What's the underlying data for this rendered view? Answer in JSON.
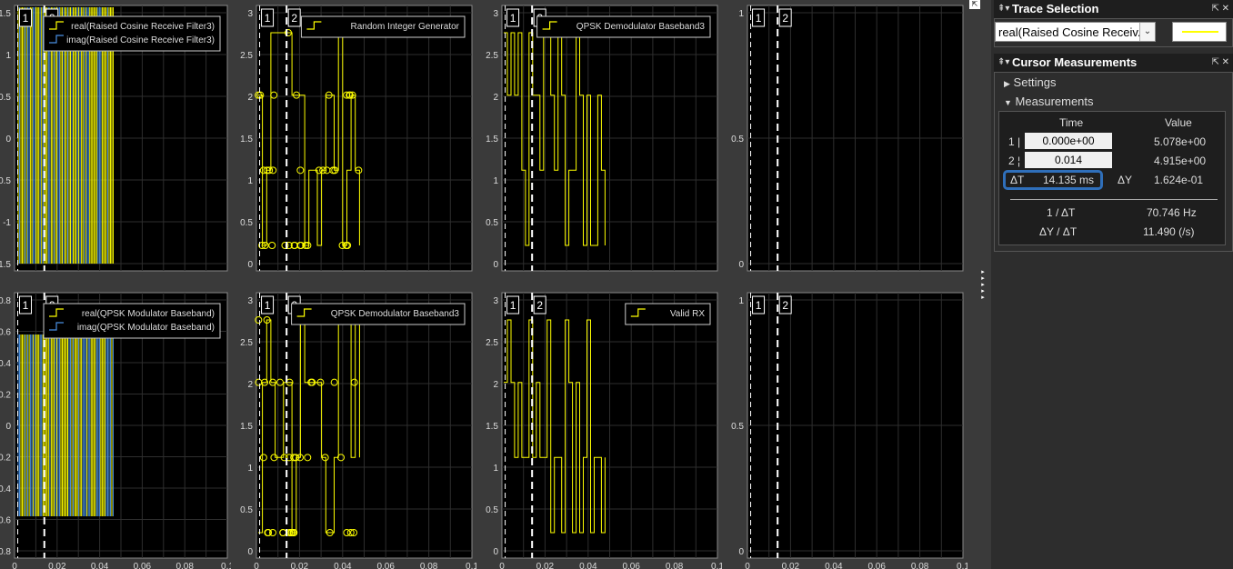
{
  "plots": [
    {
      "legend": {
        "entries": [
          {
            "label": "real(Raised Cosine Receive Filter3)",
            "color": "#ffff00"
          },
          {
            "label": "imag(Raised Cosine Receive Filter3)",
            "color": "#4a90e2"
          }
        ]
      },
      "yticks": [
        "1.5",
        "1",
        "0.5",
        "0",
        "-0.5",
        "-1",
        "-1.5"
      ],
      "xticks": [],
      "cursor_labels": [
        "1",
        "2"
      ]
    },
    {
      "legend": {
        "entries": [
          {
            "label": "Random Integer Generator",
            "color": "#ffff00"
          }
        ]
      },
      "yticks": [
        "3",
        "2.5",
        "2",
        "1.5",
        "1",
        "0.5",
        "0"
      ],
      "xticks": [],
      "cursor_labels": [
        "1",
        "2"
      ]
    },
    {
      "legend": {
        "entries": [
          {
            "label": "QPSK Demodulator Baseband3",
            "color": "#ffff00"
          }
        ]
      },
      "yticks": [
        "3",
        "2.5",
        "2",
        "1.5",
        "1",
        "0.5",
        "0"
      ],
      "xticks": [],
      "cursor_labels": [
        "1",
        "2"
      ]
    },
    {
      "legend": {
        "entries": []
      },
      "yticks": [
        "1",
        "0.5",
        "0"
      ],
      "xticks": [],
      "cursor_labels": [
        "1",
        "2"
      ]
    },
    {
      "legend": {
        "entries": [
          {
            "label": "real(QPSK Modulator Baseband)",
            "color": "#ffff00"
          },
          {
            "label": "imag(QPSK Modulator Baseband)",
            "color": "#4a90e2"
          }
        ]
      },
      "yticks": [
        "0.8",
        "0.6",
        "0.4",
        "0.2",
        "0",
        "-0.2",
        "-0.4",
        "-0.6",
        "-0.8"
      ],
      "xticks": [
        "0",
        "0.02",
        "0.04",
        "0.06",
        "0.08",
        "0.1"
      ],
      "cursor_labels": [
        "1",
        "2"
      ]
    },
    {
      "legend": {
        "entries": [
          {
            "label": "QPSK Demodulator Baseband3",
            "color": "#ffff00"
          }
        ]
      },
      "yticks": [
        "3",
        "2.5",
        "2",
        "1.5",
        "1",
        "0.5",
        "0"
      ],
      "xticks": [
        "0",
        "0.02",
        "0.04",
        "0.06",
        "0.08",
        "0.1"
      ],
      "cursor_labels": [
        "1",
        "2"
      ]
    },
    {
      "legend": {
        "entries": [
          {
            "label": "Valid RX",
            "color": "#ffff00"
          }
        ]
      },
      "yticks": [
        "3",
        "2.5",
        "2",
        "1.5",
        "1",
        "0.5",
        "0"
      ],
      "xticks": [
        "0",
        "0.02",
        "0.04",
        "0.06",
        "0.08",
        "0.1"
      ],
      "cursor_labels": [
        "1",
        "2"
      ]
    },
    {
      "legend": {
        "entries": []
      },
      "yticks": [
        "1",
        "0.5",
        "0"
      ],
      "xticks": [
        "0",
        "0.02",
        "0.04",
        "0.06",
        "0.08",
        "0.1"
      ],
      "cursor_labels": [
        "1",
        "2"
      ]
    }
  ],
  "trace_selection": {
    "title": "Trace Selection",
    "selected_trace": "real(Raised Cosine Receiv...",
    "line_color": "#ffff00"
  },
  "cursor_measurements": {
    "title": "Cursor Measurements",
    "settings_label": "Settings",
    "measurements_label": "Measurements",
    "col_time": "Time",
    "col_value": "Value",
    "row1_label": "1",
    "row1_time": "0.000e+00",
    "row1_value": "5.078e+00",
    "row2_label": "2",
    "row2_time": "0.014",
    "row2_value": "4.915e+00",
    "dt_label": "ΔT",
    "dt_value": "14.135 ms",
    "dy_label": "ΔY",
    "dy_value": "1.624e-01",
    "inv_dt_label": "1 / ΔT",
    "inv_dt_value": "70.746 Hz",
    "dydt_label": "ΔY / ΔT",
    "dydt_value": "11.490 (/s)"
  },
  "icons": {
    "pin": "pin-icon",
    "menu": "menu-arrow-icon",
    "undock": "undock-icon",
    "close": "close-icon",
    "expand": "expand-arrows-icon"
  }
}
